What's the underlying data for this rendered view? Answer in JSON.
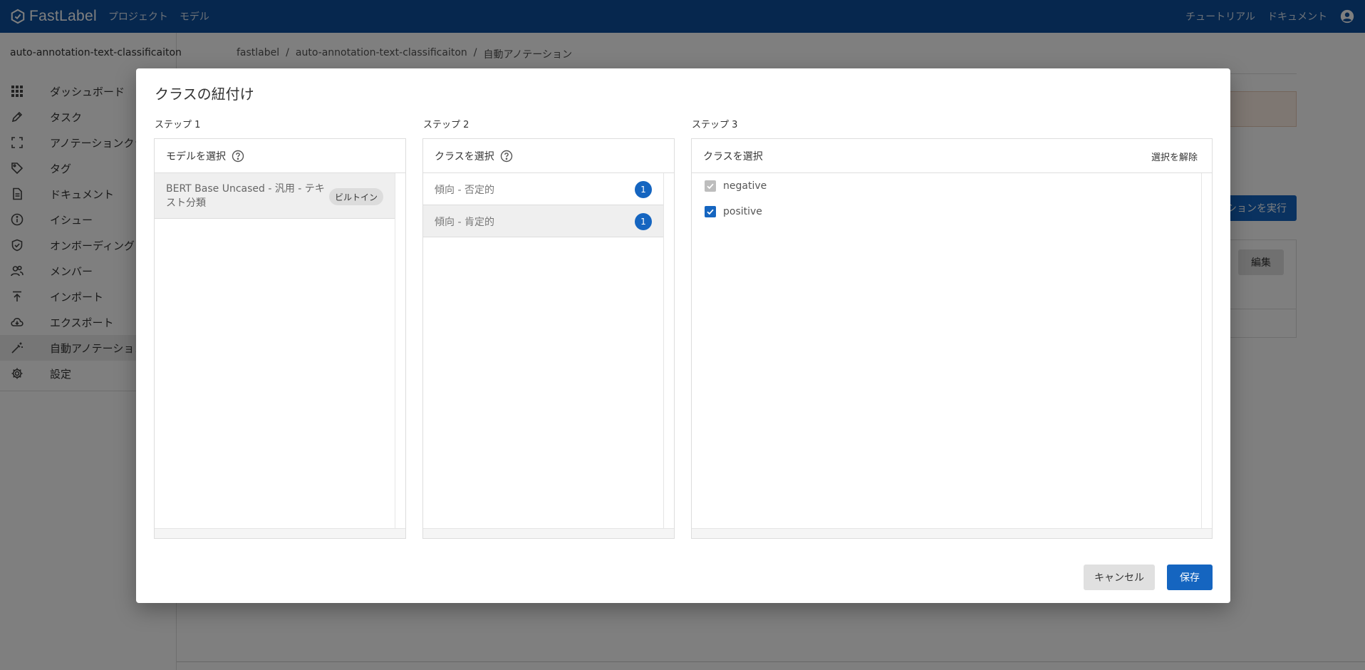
{
  "app": {
    "brand": "FastLabel",
    "nav": [
      "プロジェクト",
      "モデル"
    ],
    "right_links": [
      "チュートリアル",
      "ドキュメント"
    ]
  },
  "sidebar": {
    "project_name": "auto-annotation-text-classificaiton",
    "items": [
      {
        "label": "ダッシュボード",
        "icon": "grid-icon"
      },
      {
        "label": "タスク",
        "icon": "pencil-icon"
      },
      {
        "label": "アノテーションクラス",
        "icon": "frame-icon"
      },
      {
        "label": "タグ",
        "icon": "tag-icon"
      },
      {
        "label": "ドキュメント",
        "icon": "document-icon"
      },
      {
        "label": "イシュー",
        "icon": "info-icon"
      },
      {
        "label": "オンボーディング",
        "icon": "shield-check-icon"
      },
      {
        "label": "メンバー",
        "icon": "people-icon"
      },
      {
        "label": "インポート",
        "icon": "upload-icon"
      },
      {
        "label": "エクスポート",
        "icon": "cloud-download-icon"
      },
      {
        "label": "自動アノテーション",
        "icon": "magic-wand-icon",
        "active": true
      },
      {
        "label": "設定",
        "icon": "gear-icon"
      }
    ]
  },
  "breadcrumb": [
    "fastlabel",
    "auto-annotation-text-classificaiton",
    "自動アノテーション"
  ],
  "background": {
    "run_button": "ションを実行",
    "edit_button": "編集"
  },
  "modal": {
    "title": "クラスの紐付け",
    "steps": [
      "ステップ 1",
      "ステップ 2",
      "ステップ 3"
    ],
    "step1": {
      "header": "モデルを選択",
      "model_name": "BERT Base Uncased - 汎用 - テキスト分類",
      "chip": "ビルトイン"
    },
    "step2": {
      "header": "クラスを選択",
      "classes": [
        {
          "label": "傾向 - 否定的",
          "count": "1",
          "selected": false
        },
        {
          "label": "傾向 - 肯定的",
          "count": "1",
          "selected": true
        }
      ]
    },
    "step3": {
      "header": "クラスを選択",
      "clear_label": "選択を解除",
      "options": [
        {
          "label": "negative",
          "checked": true,
          "disabled": true
        },
        {
          "label": "positive",
          "checked": true,
          "disabled": false
        }
      ]
    },
    "cancel_label": "キャンセル",
    "save_label": "保存"
  },
  "colors": {
    "topbar": "#0d4e9c",
    "primary": "#1565c0"
  }
}
